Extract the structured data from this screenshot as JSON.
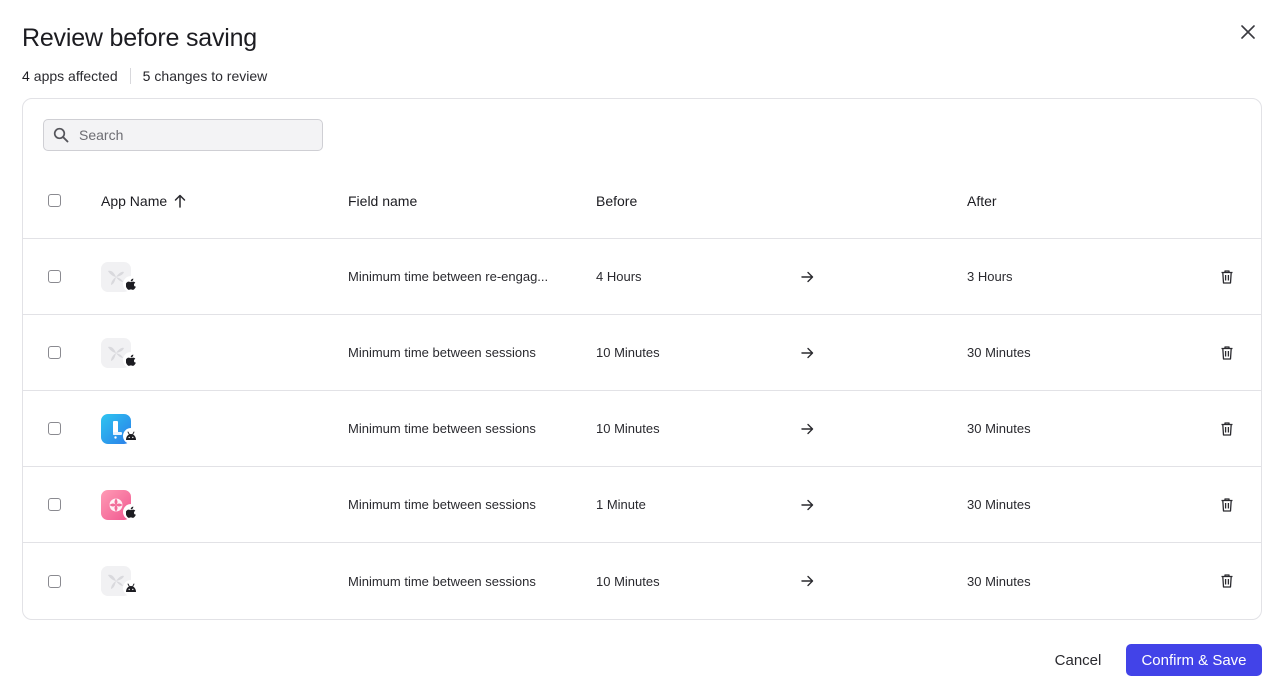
{
  "dialog": {
    "title": "Review before saving",
    "close_icon": "close-icon"
  },
  "summary": {
    "apps_count": "4",
    "apps_label": "apps affected",
    "changes_count": "5",
    "changes_label": "changes to review"
  },
  "search": {
    "placeholder": "Search",
    "value": ""
  },
  "table": {
    "columns": {
      "app_name": "App Name",
      "field_name": "Field name",
      "before": "Before",
      "after": "After"
    },
    "sort": {
      "column": "app_name",
      "direction": "ascending",
      "icon": "arrow-up-icon"
    },
    "rows": [
      {
        "app_icon": "placeholder-app-icon",
        "platform": "apple-icon",
        "field": "Minimum time between re-engagement",
        "field_display": "Minimum time between re-engag...",
        "before": "4 Hours",
        "after": "3 Hours"
      },
      {
        "app_icon": "placeholder-app-icon",
        "platform": "apple-icon",
        "field": "Minimum time between sessions",
        "field_display": "Minimum time between sessions",
        "before": "10 Minutes",
        "after": "30 Minutes"
      },
      {
        "app_icon": "blue-app-icon",
        "platform": "android-icon",
        "field": "Minimum time between sessions",
        "field_display": "Minimum time between sessions",
        "before": "10 Minutes",
        "after": "30 Minutes"
      },
      {
        "app_icon": "pink-app-icon",
        "platform": "apple-icon",
        "field": "Minimum time between sessions",
        "field_display": "Minimum time between sessions",
        "before": "1 Minute",
        "after": "30 Minutes"
      },
      {
        "app_icon": "placeholder-app-icon",
        "platform": "android-icon",
        "field": "Minimum time between sessions",
        "field_display": "Minimum time between sessions",
        "before": "10 Minutes",
        "after": "30 Minutes"
      }
    ]
  },
  "footer": {
    "cancel_label": "Cancel",
    "confirm_label": "Confirm & Save"
  },
  "colors": {
    "primary": "#4243e8",
    "border": "#e2e2e6",
    "text": "#1c1c21"
  }
}
